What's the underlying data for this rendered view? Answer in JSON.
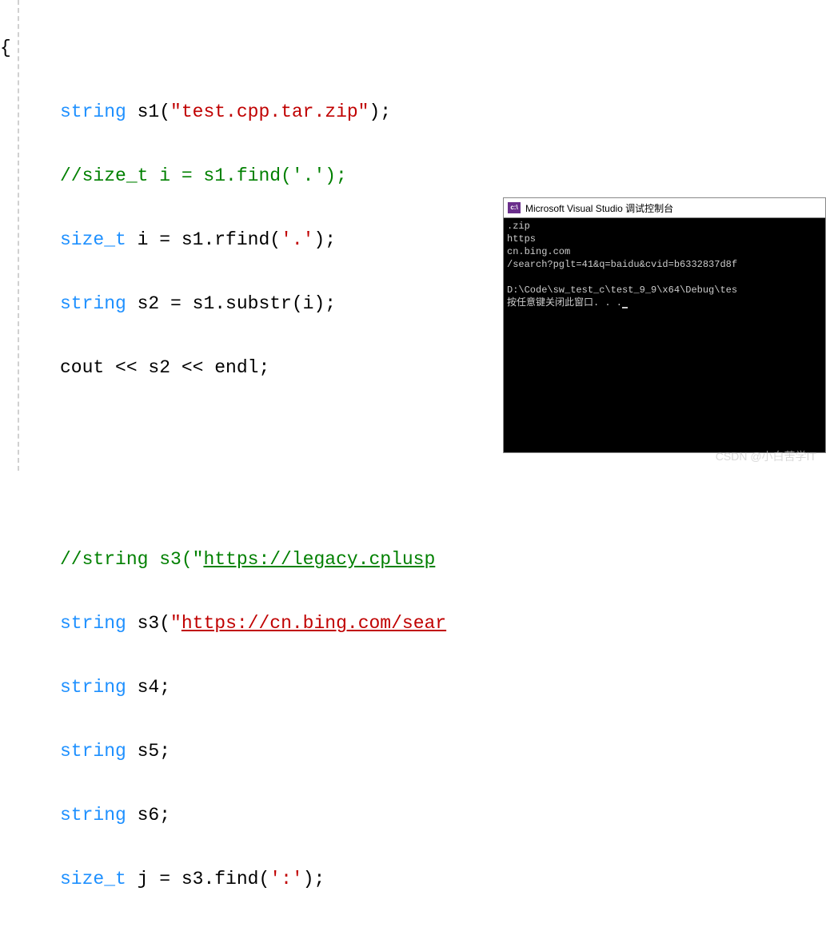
{
  "code": {
    "brace": "{",
    "l1_kw": "string",
    "l1_var": " s1(",
    "l1_str": "\"test.cpp.tar.zip\"",
    "l1_end": ");",
    "l2": "//size_t i = s1.find('.');",
    "l3_kw": "size_t",
    "l3_mid": " i = s1.rfind(",
    "l3_chr": "'.'",
    "l3_end": ");",
    "l4_kw": "string",
    "l4_rest": " s2 = s1.substr(i);",
    "l5": "cout << s2 << endl;",
    "l6_pre": "//string s3(\"",
    "l6_link": "https://legacy.cplusp",
    "l7_kw": "string",
    "l7_mid": " s3(",
    "l7_q": "\"",
    "l7_link": "https://cn.bing.com/sear",
    "l8_kw": "string",
    "l8_rest": " s4;",
    "l9_kw": "string",
    "l9_rest": " s5;",
    "l10_kw": "string",
    "l10_rest": " s6;",
    "l11_kw": "size_t",
    "l11_mid": " j = s3.find(",
    "l11_chr": "':'",
    "l11_end": ");"
  },
  "console": {
    "title": "Microsoft Visual Studio 调试控制台",
    "out1": ".zip",
    "out2": "https",
    "out3": "cn.bing.com",
    "out4": "/search?pglt=41&q=baidu&cvid=b6332837d8f",
    "blank": "",
    "out5": "D:\\Code\\sw_test_c\\test_9_9\\x64\\Debug\\tes",
    "out6": "按任意键关闭此窗口. . ."
  },
  "watermark": "CSDN @小白苦学IT"
}
